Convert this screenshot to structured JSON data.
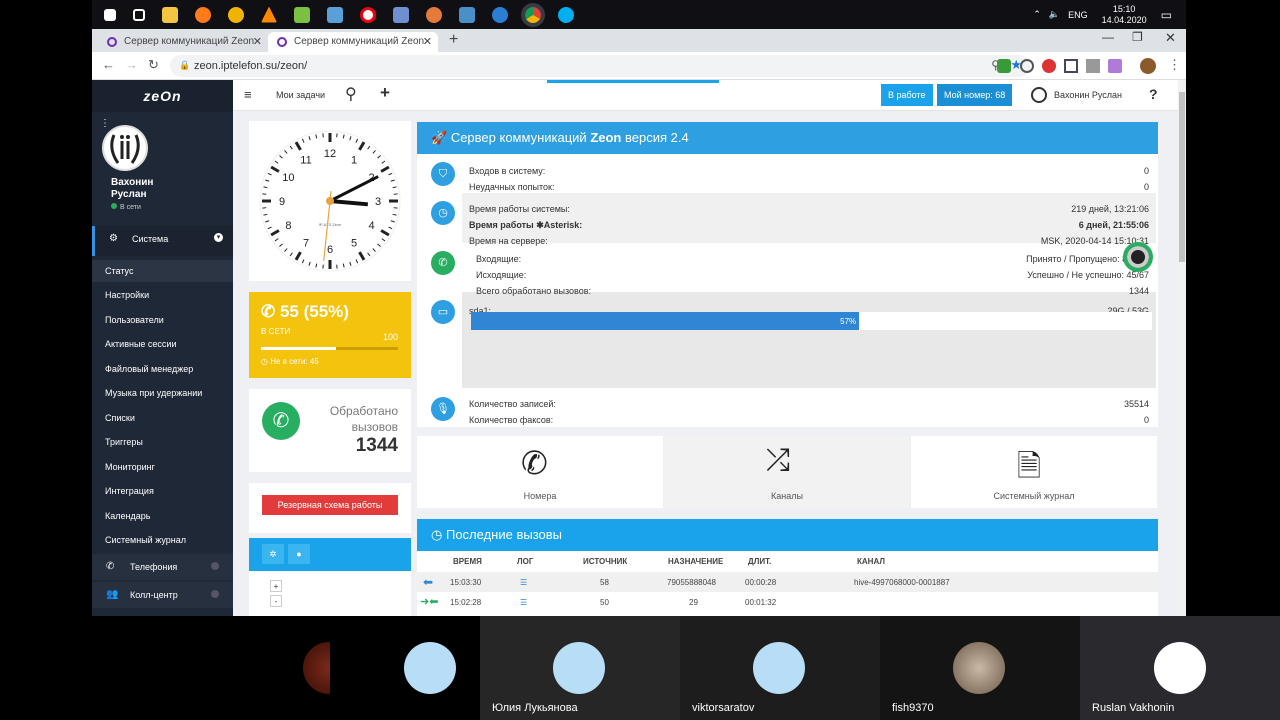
{
  "system": {
    "time": "15:10",
    "date": "14.04.2020",
    "lang": "ENG"
  },
  "browser": {
    "tabs": [
      "Сервер коммуникаций Zeon",
      "Сервер коммуникаций Zeon"
    ],
    "url": "zeon.iptelefon.su/zeon/"
  },
  "sidebar": {
    "logo": "zeOn",
    "user_first": "Вахонин",
    "user_last": "Руслан",
    "status": "В сети",
    "menu_head": "Система",
    "active": "Статус",
    "items": [
      "Настройки",
      "Пользователи",
      "Активные сессии",
      "Файловый менеджер",
      "Музыка при удержании",
      "Списки",
      "Триггеры",
      "Мониторинг",
      "Интеграция",
      "Календарь",
      "Системный журнал"
    ],
    "bottom": [
      "Телефония",
      "Колл-центр"
    ]
  },
  "topbar": {
    "tasks": "Мои задачи",
    "btn_work": "В работе",
    "btn_number": "Мой номер: 68",
    "user": "Вахонин Руслан",
    "help": "?"
  },
  "widgets": {
    "online_count": "55 (55%)",
    "online_label": "В СЕТИ",
    "online_total": "100",
    "online_progress": 0.55,
    "offline": "Не в сети: 45",
    "processed_label": "Обработано вызовов",
    "processed": "1344",
    "reserve": "Резервная схема работы",
    "clock_brand": "IP-ATS Zeon"
  },
  "server": {
    "title_a": "Сервер коммуникаций ",
    "title_b": "Zeon",
    "title_c": " версия 2.4",
    "rows": [
      [
        "Входов в систему:",
        "0"
      ],
      [
        "Неудачных попыток:",
        "0"
      ],
      [
        "Время работы системы:",
        "219 дней, 13:21:06"
      ],
      [
        "Время работы ✱Asterisk:",
        "6 дней, 21:55:06"
      ],
      [
        "Время на сервере:",
        "MSK, 2020-04-14 15:10:31"
      ],
      [
        "Входящие:",
        "Принято / Пропущено: 86/113"
      ],
      [
        "Исходящие:",
        "Успешно / Не успешно: 45/67"
      ],
      [
        "Всего обработано вызовов:",
        "1344"
      ],
      [
        "sda1:",
        "29G / 53G"
      ],
      [
        "Количество записей:",
        "35514"
      ],
      [
        "Количество факсов:",
        "0"
      ]
    ],
    "disk_pct": "57%",
    "disk_fill": 0.57
  },
  "cards": [
    "Номера",
    "Каналы",
    "Системный журнал"
  ],
  "recent": {
    "title": "Последние вызовы",
    "headers": [
      "ВРЕМЯ",
      "ЛОГ",
      "ИСТОЧНИК",
      "НАЗНАЧЕНИЕ",
      "ДЛИТ.",
      "КАНАЛ"
    ],
    "rows": [
      [
        "15:03:30",
        "58",
        "79055888048",
        "00:00:28",
        "hive-4997068000-0001887"
      ],
      [
        "15:02:28",
        "50",
        "29",
        "00:01:32",
        ""
      ]
    ]
  },
  "video": {
    "participants": [
      "",
      "",
      "Юлия Лукьянова",
      "viktorsaratov",
      "fish9370",
      "Ruslan Vakhonin"
    ]
  },
  "colors": {
    "accent": "#1aa3ea",
    "yellow": "#f3c30d",
    "green": "#27ae60",
    "red": "#e23b3b",
    "sidebar": "#1f2836"
  }
}
